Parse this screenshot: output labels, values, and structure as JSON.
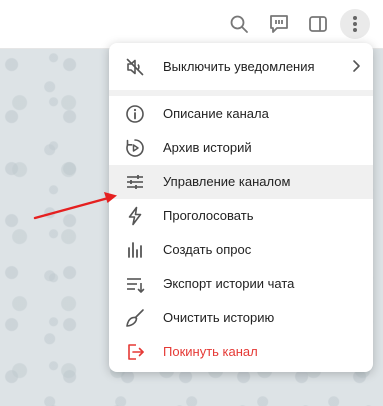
{
  "topbar": {
    "icons": [
      "search-icon",
      "comments-icon",
      "sidebar-toggle-icon",
      "more-vertical-icon"
    ]
  },
  "menu": {
    "mute": {
      "label": "Выключить уведомления",
      "icon": "mute-icon"
    },
    "items": [
      {
        "label": "Описание канала",
        "icon": "info-icon"
      },
      {
        "label": "Архив историй",
        "icon": "stories-archive-icon"
      },
      {
        "label": "Управление каналом",
        "icon": "sliders-icon"
      },
      {
        "label": "Проголосовать",
        "icon": "boost-icon"
      },
      {
        "label": "Создать опрос",
        "icon": "poll-icon"
      },
      {
        "label": "Экспорт истории чата",
        "icon": "export-icon"
      },
      {
        "label": "Очистить историю",
        "icon": "broom-icon"
      },
      {
        "label": "Покинуть канал",
        "icon": "leave-icon"
      }
    ],
    "highlighted_index": 2
  },
  "colors": {
    "danger": "#e53935",
    "annotation_arrow": "#e52020",
    "icon": "#555555"
  }
}
